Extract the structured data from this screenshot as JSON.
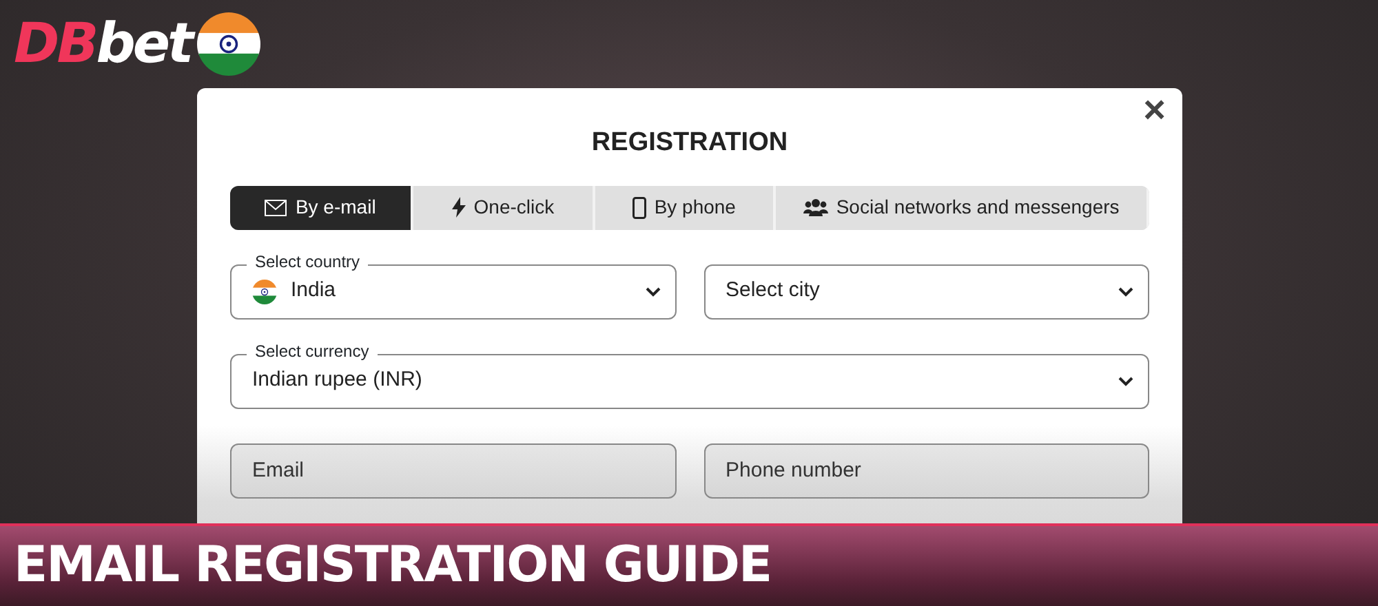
{
  "logo": [
    "DB",
    "bet"
  ],
  "modal": {
    "title": "REGISTRATION",
    "close": "×",
    "tabs": [
      {
        "label": "By e-mail",
        "selected": true
      },
      {
        "label": "One-click",
        "selected": false
      },
      {
        "label": "By phone",
        "selected": false
      },
      {
        "label": "Social networks and messengers",
        "selected": false
      }
    ],
    "rows": [
      [
        {
          "kind": "select",
          "label": "Select country",
          "value": "India",
          "flag": true
        },
        {
          "kind": "select",
          "value": "Select city"
        }
      ],
      [
        {
          "kind": "select",
          "label": "Select currency",
          "value": "Indian rupee (INR)"
        }
      ],
      [
        {
          "kind": "input",
          "placeholder": "Email"
        },
        {
          "kind": "input",
          "placeholder": "Phone number"
        }
      ]
    ]
  },
  "banner": {
    "title": "EMAIL REGISTRATION GUIDE"
  }
}
